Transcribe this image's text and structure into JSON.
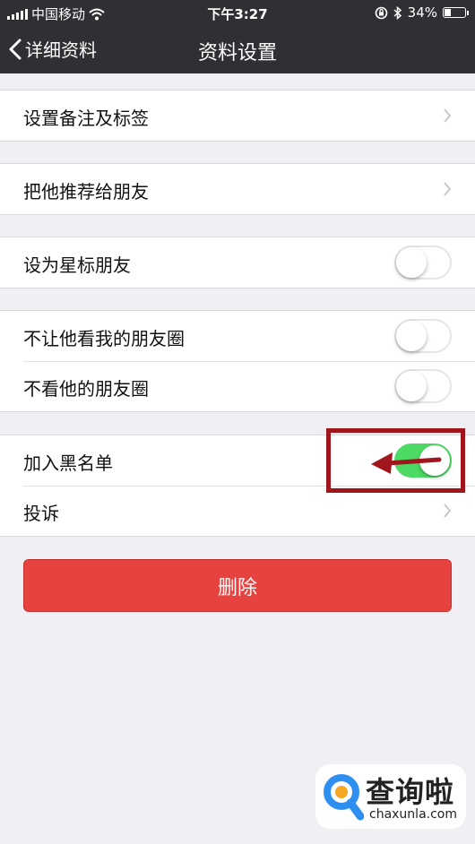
{
  "status_bar": {
    "carrier": "中国移动",
    "time": "下午3:27",
    "battery_percent": "34%",
    "battery_level": 0.34
  },
  "nav": {
    "back_label": "详细资料",
    "title": "资料设置"
  },
  "groups": [
    {
      "items": [
        {
          "label": "设置备注及标签",
          "type": "link"
        }
      ]
    },
    {
      "items": [
        {
          "label": "把他推荐给朋友",
          "type": "link"
        }
      ]
    },
    {
      "items": [
        {
          "label": "设为星标朋友",
          "type": "toggle",
          "on": false
        }
      ]
    },
    {
      "items": [
        {
          "label": "不让他看我的朋友圈",
          "type": "toggle",
          "on": false
        },
        {
          "label": "不看他的朋友圈",
          "type": "toggle",
          "on": false
        }
      ]
    },
    {
      "items": [
        {
          "label": "加入黑名单",
          "type": "toggle",
          "on": true
        },
        {
          "label": "投诉",
          "type": "link"
        }
      ]
    }
  ],
  "delete_button": {
    "label": "删除"
  },
  "watermark": {
    "name": "查询啦",
    "url": "chaxunla.com"
  },
  "colors": {
    "nav_bg": "#303034",
    "page_bg": "#efeff4",
    "toggle_on": "#4cd964",
    "delete_red": "#e64340",
    "annotation_red": "#a1151c",
    "logo_blue": "#2e8ff0",
    "logo_orange": "#f5a623"
  }
}
